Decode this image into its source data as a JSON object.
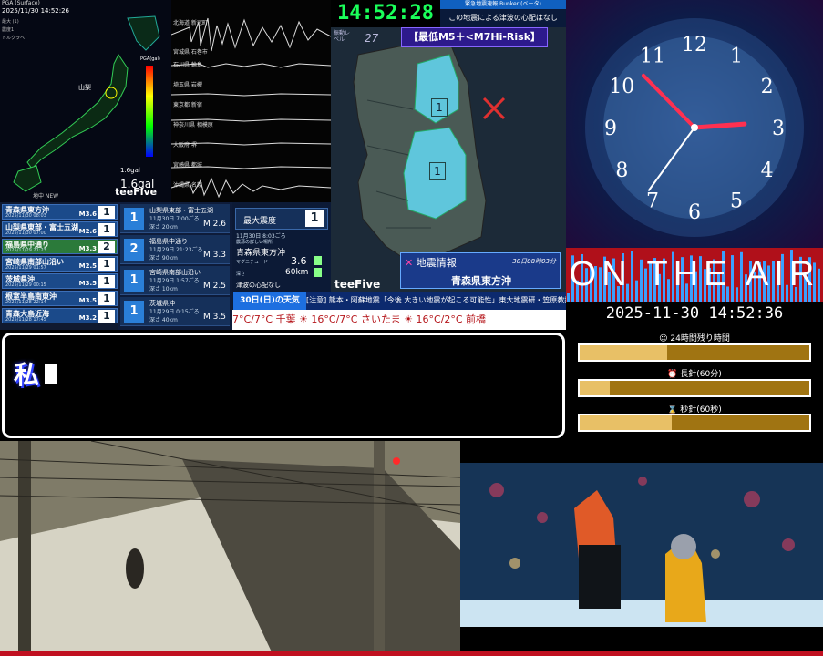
{
  "map_panel": {
    "title": "PGA (Surface)",
    "datetime": "2025/11/30 14:52:26",
    "legend_title": "PGA(gal)",
    "legend_ticks": [
      "1000",
      "100",
      "10",
      "1",
      "0.1"
    ],
    "peak_label": "1.6gal",
    "peak_value": "1.6gal",
    "footer": "地中 NEW",
    "brand": "teeFive",
    "stats": [
      "最大 (1)",
      "震度1",
      "トルクラヘ"
    ]
  },
  "seismograph": {
    "stations": [
      "北海道 新冠町",
      "宮城県 石巻市",
      "石川県 輪島",
      "埼玉県 岩槻",
      "東京都 新宿",
      "神奈川県 相模原",
      "大阪府 堺",
      "宮崎県 都城",
      "沖縄県 名護"
    ]
  },
  "quake_list": [
    {
      "name": "青森県東方沖",
      "time": "2025/11/30 08:03",
      "mag": "M3.6",
      "intensity": "1",
      "color": "#1b4a8a"
    },
    {
      "name": "山梨県東部・富士五湖",
      "time": "2025/11/30 07:00",
      "mag": "M2.6",
      "intensity": "1",
      "color": "#1b4a8a"
    },
    {
      "name": "福島県中通り",
      "time": "2025/11/29 21:23",
      "mag": "M3.3",
      "intensity": "2",
      "color": "#2b7a3a"
    },
    {
      "name": "宮崎県南部山沿い",
      "time": "2025/11/29 01:57",
      "mag": "M2.5",
      "intensity": "1",
      "color": "#1b4a8a"
    },
    {
      "name": "茨城県沖",
      "time": "2025/11/29 00:15",
      "mag": "M3.5",
      "intensity": "1",
      "color": "#1b4a8a"
    },
    {
      "name": "根室半島南東沖",
      "time": "2025/11/28 22:14",
      "mag": "M3.5",
      "intensity": "1",
      "color": "#1b4a8a"
    },
    {
      "name": "青森大島近海",
      "time": "2025/11/28 17:45",
      "mag": "M3.2",
      "intensity": "1",
      "color": "#1b4a8a"
    }
  ],
  "detail_list": [
    {
      "name": "山梨県東部・富士五湖",
      "time": "11月30日 7:00ごろ",
      "depth": "深さ 20km",
      "mag": "M 2.6",
      "intensity": "1"
    },
    {
      "name": "福島県中通り",
      "time": "11月29日 21:23ごろ",
      "depth": "深さ 90km",
      "mag": "M 3.3",
      "intensity": "2"
    },
    {
      "name": "宮崎県南部山沿い",
      "time": "11月29日 1:57ごろ",
      "depth": "深さ 10km",
      "mag": "M 2.5",
      "intensity": "1"
    },
    {
      "name": "茨城県沖",
      "time": "11月29日 0:15ごろ",
      "depth": "深さ 40km",
      "mag": "M 3.5",
      "intensity": "1"
    }
  ],
  "max_intensity": {
    "label": "最大震度",
    "value": "1",
    "time": "11月30日 8:03ごろ",
    "region_head": "震源の詳しい場所",
    "region": "青森県東方沖",
    "mag_label": "マグニチュード",
    "mag_value": "3.6",
    "depth_label": "深さ",
    "depth_value": "60km",
    "tsunami": "津波の心配なし"
  },
  "tohoku": {
    "clock": "14:52:28",
    "banner_top": "緊急地震速報 Bunker (ベータ)",
    "tsunami_note": "この地震による津波の心配はなし",
    "level_label": "振動レベル",
    "level_value": "27",
    "risk": "【最低M5＋<M7Hi-Risk】",
    "info_title": "地震情報",
    "info_time": "30日08時03分",
    "info_region": "青森県東方沖",
    "brand": "teeFive",
    "pref_intensity_1": "1",
    "pref_intensity_2": "1"
  },
  "ticker": {
    "weather_head": "30日(日)の天気",
    "news": "[注意] 熊本・阿蘇地震「今後 大きい地震が起こる可能性」東大地震研・笠原教授",
    "weather": "7°C/7°C   千葉 ☀ 16°C/7°C   さいたま ☀ 16°C/2°C   前橋"
  },
  "clock_panel": {
    "numerals": [
      "12",
      "1",
      "2",
      "3",
      "4",
      "5",
      "6",
      "7",
      "8",
      "9",
      "10",
      "11"
    ],
    "hour": 14,
    "minute": 52,
    "second": 36,
    "on_air": "ON THE AIR",
    "datetime": "2025-11-30 14:52:36"
  },
  "timers": [
    {
      "label": "☺ 24時間残り時間",
      "fill": 0.38
    },
    {
      "label": "⏰ 長針(60分)",
      "fill": 0.13
    },
    {
      "label": "⌛ 秒針(60秒)",
      "fill": 0.4
    }
  ],
  "chat": {
    "text": "私"
  }
}
